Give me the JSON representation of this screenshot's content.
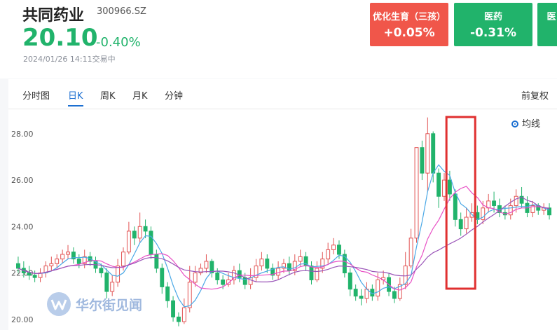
{
  "stock": {
    "name": "共同药业",
    "code": "300966.SZ",
    "price": "20.10",
    "change_pct": "-0.40%",
    "time": "2024/01/26 14:11交易中",
    "price_color": "#21b36b"
  },
  "sectors": [
    {
      "name": "优化生育（三孩）",
      "change": "+0.05%",
      "color": "#f0564a"
    },
    {
      "name": "医药",
      "change": "-0.31%",
      "color": "#21b36b"
    },
    {
      "name": "医",
      "change": "",
      "color": "#21b36b"
    }
  ],
  "tabs": [
    "分时图",
    "日K",
    "周K",
    "月K",
    "分钟"
  ],
  "active_tab": "日K",
  "adjust_label": "前复权",
  "legend_label": "均线",
  "watermark": "华尔街见闻",
  "chart_data": {
    "type": "candlestick",
    "ylim": [
      19.6,
      28.9
    ],
    "y_ticks": [
      20.0,
      22.0,
      24.0,
      26.0,
      28.0
    ],
    "y_tick_labels": [
      "20.00",
      "22.00",
      "24.00",
      "26.00",
      "28.00"
    ],
    "up_color": "#e25454",
    "down_color": "#21b36b",
    "highlight_box": {
      "from_index": 78,
      "to_index": 82,
      "color": "#e03030"
    },
    "candles": [
      [
        22.4,
        22.2,
        22.7,
        22.0
      ],
      [
        22.2,
        22.0,
        22.5,
        21.8
      ],
      [
        22.0,
        21.9,
        22.3,
        21.7
      ],
      [
        21.9,
        21.8,
        22.1,
        21.6
      ],
      [
        21.8,
        22.0,
        22.2,
        21.6
      ],
      [
        22.0,
        22.3,
        22.5,
        21.8
      ],
      [
        22.3,
        22.4,
        22.7,
        22.1
      ],
      [
        22.4,
        22.6,
        22.8,
        22.2
      ],
      [
        22.6,
        22.8,
        23.0,
        22.4
      ],
      [
        22.8,
        22.9,
        23.2,
        22.6
      ],
      [
        22.9,
        22.6,
        23.1,
        22.4
      ],
      [
        22.6,
        22.4,
        22.8,
        22.2
      ],
      [
        22.4,
        22.7,
        23.0,
        22.2
      ],
      [
        22.7,
        22.5,
        22.9,
        22.3
      ],
      [
        22.5,
        22.2,
        22.7,
        22.0
      ],
      [
        22.2,
        22.0,
        22.4,
        21.8
      ],
      [
        22.0,
        21.2,
        22.2,
        20.9
      ],
      [
        21.2,
        21.6,
        21.9,
        21.0
      ],
      [
        21.6,
        22.3,
        22.6,
        21.4
      ],
      [
        22.3,
        22.9,
        23.1,
        22.1
      ],
      [
        22.9,
        23.8,
        24.2,
        22.8
      ],
      [
        23.8,
        23.5,
        24.0,
        23.2
      ],
      [
        23.5,
        24.0,
        24.6,
        23.3
      ],
      [
        24.0,
        23.8,
        24.3,
        23.5
      ],
      [
        23.8,
        22.8,
        24.0,
        22.6
      ],
      [
        22.8,
        22.2,
        23.0,
        22.0
      ],
      [
        22.2,
        21.4,
        22.4,
        21.1
      ],
      [
        21.4,
        20.8,
        21.6,
        20.5
      ],
      [
        20.8,
        20.1,
        21.0,
        19.9
      ],
      [
        20.1,
        19.9,
        20.3,
        19.7
      ],
      [
        19.9,
        20.5,
        20.9,
        19.8
      ],
      [
        20.5,
        21.6,
        22.3,
        20.3
      ],
      [
        21.6,
        22.0,
        22.3,
        21.4
      ],
      [
        22.0,
        22.2,
        22.4,
        21.9
      ],
      [
        22.2,
        22.5,
        22.8,
        22.0
      ],
      [
        22.5,
        22.0,
        22.6,
        21.8
      ],
      [
        22.0,
        21.7,
        22.2,
        21.5
      ],
      [
        21.7,
        21.5,
        21.9,
        21.3
      ],
      [
        21.5,
        21.7,
        22.0,
        21.4
      ],
      [
        21.7,
        22.1,
        22.3,
        21.5
      ],
      [
        22.1,
        21.8,
        22.4,
        21.6
      ],
      [
        21.8,
        21.5,
        22.0,
        21.3
      ],
      [
        21.5,
        21.8,
        22.2,
        21.3
      ],
      [
        21.8,
        22.3,
        22.6,
        21.6
      ],
      [
        22.3,
        22.6,
        22.9,
        22.1
      ],
      [
        22.6,
        22.2,
        22.8,
        22.0
      ],
      [
        22.2,
        21.9,
        22.4,
        21.7
      ],
      [
        21.9,
        22.2,
        22.5,
        21.7
      ],
      [
        22.2,
        22.4,
        22.6,
        22.0
      ],
      [
        22.4,
        22.1,
        22.7,
        21.9
      ],
      [
        22.1,
        22.5,
        22.8,
        21.9
      ],
      [
        22.5,
        22.7,
        23.0,
        22.3
      ],
      [
        22.7,
        22.3,
        22.9,
        22.1
      ],
      [
        22.3,
        21.7,
        22.5,
        21.5
      ],
      [
        21.7,
        22.2,
        22.5,
        21.6
      ],
      [
        22.2,
        22.6,
        22.9,
        22.0
      ],
      [
        22.6,
        23.0,
        23.3,
        22.4
      ],
      [
        23.0,
        23.2,
        23.5,
        22.8
      ],
      [
        23.2,
        22.8,
        23.4,
        22.6
      ],
      [
        22.8,
        22.0,
        23.0,
        21.8
      ],
      [
        22.0,
        21.3,
        22.2,
        21.0
      ],
      [
        21.3,
        21.0,
        21.5,
        20.8
      ],
      [
        21.0,
        20.9,
        21.3,
        20.6
      ],
      [
        20.9,
        21.3,
        21.6,
        20.7
      ],
      [
        21.3,
        21.0,
        21.5,
        20.8
      ],
      [
        21.0,
        21.7,
        22.0,
        20.8
      ],
      [
        21.7,
        21.8,
        22.1,
        21.5
      ],
      [
        21.8,
        21.2,
        22.0,
        21.0
      ],
      [
        21.2,
        20.9,
        21.4,
        20.7
      ],
      [
        20.9,
        21.5,
        21.8,
        20.8
      ],
      [
        21.5,
        22.3,
        22.9,
        21.3
      ],
      [
        22.3,
        23.5,
        23.9,
        22.2
      ],
      [
        23.5,
        27.4,
        27.4,
        23.3
      ],
      [
        27.4,
        26.3,
        27.7,
        26.0
      ],
      [
        26.3,
        28.0,
        28.7,
        25.5
      ],
      [
        28.0,
        26.3,
        28.1,
        25.9
      ],
      [
        26.3,
        25.3,
        26.5,
        24.8
      ],
      [
        25.3,
        26.0,
        26.3,
        25.1
      ],
      [
        26.0,
        25.4,
        26.4,
        25.1
      ],
      [
        25.4,
        24.3,
        25.6,
        24.0
      ],
      [
        24.3,
        23.9,
        24.6,
        23.6
      ],
      [
        23.9,
        24.4,
        24.8,
        23.7
      ],
      [
        24.4,
        24.6,
        25.0,
        24.2
      ],
      [
        24.6,
        24.3,
        24.9,
        24.1
      ],
      [
        24.3,
        24.8,
        25.1,
        24.1
      ],
      [
        24.8,
        25.1,
        25.4,
        24.6
      ],
      [
        25.1,
        24.9,
        25.5,
        24.6
      ],
      [
        24.9,
        24.6,
        25.2,
        24.4
      ],
      [
        24.6,
        24.5,
        24.9,
        24.3
      ],
      [
        24.5,
        24.9,
        25.2,
        24.3
      ],
      [
        24.9,
        25.3,
        25.6,
        24.6
      ],
      [
        25.3,
        25.0,
        25.7,
        24.8
      ],
      [
        25.0,
        24.6,
        25.3,
        24.4
      ],
      [
        24.6,
        24.9,
        25.1,
        24.4
      ],
      [
        24.9,
        24.7,
        25.0,
        24.5
      ],
      [
        24.7,
        24.8,
        25.0,
        24.5
      ],
      [
        24.8,
        24.5,
        25.0,
        24.3
      ]
    ]
  }
}
